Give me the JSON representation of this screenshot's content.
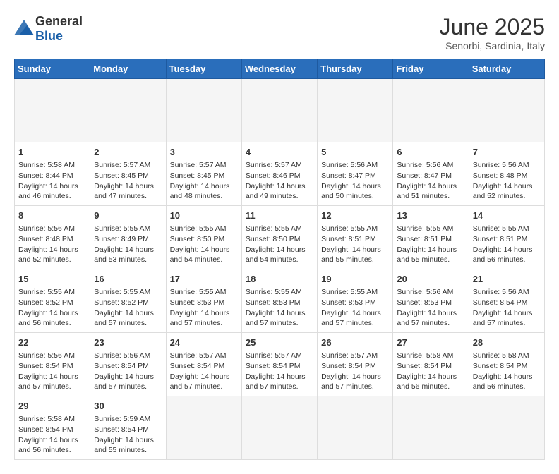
{
  "header": {
    "logo_general": "General",
    "logo_blue": "Blue",
    "title": "June 2025",
    "subtitle": "Senorbi, Sardinia, Italy"
  },
  "calendar": {
    "days_of_week": [
      "Sunday",
      "Monday",
      "Tuesday",
      "Wednesday",
      "Thursday",
      "Friday",
      "Saturday"
    ],
    "weeks": [
      [
        {
          "day": "",
          "empty": true
        },
        {
          "day": "",
          "empty": true
        },
        {
          "day": "",
          "empty": true
        },
        {
          "day": "",
          "empty": true
        },
        {
          "day": "",
          "empty": true
        },
        {
          "day": "",
          "empty": true
        },
        {
          "day": "",
          "empty": true
        }
      ],
      [
        {
          "day": "1",
          "sunrise": "5:58 AM",
          "sunset": "8:44 PM",
          "daylight": "14 hours and 46 minutes."
        },
        {
          "day": "2",
          "sunrise": "5:57 AM",
          "sunset": "8:45 PM",
          "daylight": "14 hours and 47 minutes."
        },
        {
          "day": "3",
          "sunrise": "5:57 AM",
          "sunset": "8:45 PM",
          "daylight": "14 hours and 48 minutes."
        },
        {
          "day": "4",
          "sunrise": "5:57 AM",
          "sunset": "8:46 PM",
          "daylight": "14 hours and 49 minutes."
        },
        {
          "day": "5",
          "sunrise": "5:56 AM",
          "sunset": "8:47 PM",
          "daylight": "14 hours and 50 minutes."
        },
        {
          "day": "6",
          "sunrise": "5:56 AM",
          "sunset": "8:47 PM",
          "daylight": "14 hours and 51 minutes."
        },
        {
          "day": "7",
          "sunrise": "5:56 AM",
          "sunset": "8:48 PM",
          "daylight": "14 hours and 52 minutes."
        }
      ],
      [
        {
          "day": "8",
          "sunrise": "5:56 AM",
          "sunset": "8:48 PM",
          "daylight": "14 hours and 52 minutes."
        },
        {
          "day": "9",
          "sunrise": "5:55 AM",
          "sunset": "8:49 PM",
          "daylight": "14 hours and 53 minutes."
        },
        {
          "day": "10",
          "sunrise": "5:55 AM",
          "sunset": "8:50 PM",
          "daylight": "14 hours and 54 minutes."
        },
        {
          "day": "11",
          "sunrise": "5:55 AM",
          "sunset": "8:50 PM",
          "daylight": "14 hours and 54 minutes."
        },
        {
          "day": "12",
          "sunrise": "5:55 AM",
          "sunset": "8:51 PM",
          "daylight": "14 hours and 55 minutes."
        },
        {
          "day": "13",
          "sunrise": "5:55 AM",
          "sunset": "8:51 PM",
          "daylight": "14 hours and 55 minutes."
        },
        {
          "day": "14",
          "sunrise": "5:55 AM",
          "sunset": "8:51 PM",
          "daylight": "14 hours and 56 minutes."
        }
      ],
      [
        {
          "day": "15",
          "sunrise": "5:55 AM",
          "sunset": "8:52 PM",
          "daylight": "14 hours and 56 minutes."
        },
        {
          "day": "16",
          "sunrise": "5:55 AM",
          "sunset": "8:52 PM",
          "daylight": "14 hours and 57 minutes."
        },
        {
          "day": "17",
          "sunrise": "5:55 AM",
          "sunset": "8:53 PM",
          "daylight": "14 hours and 57 minutes."
        },
        {
          "day": "18",
          "sunrise": "5:55 AM",
          "sunset": "8:53 PM",
          "daylight": "14 hours and 57 minutes."
        },
        {
          "day": "19",
          "sunrise": "5:55 AM",
          "sunset": "8:53 PM",
          "daylight": "14 hours and 57 minutes."
        },
        {
          "day": "20",
          "sunrise": "5:56 AM",
          "sunset": "8:53 PM",
          "daylight": "14 hours and 57 minutes."
        },
        {
          "day": "21",
          "sunrise": "5:56 AM",
          "sunset": "8:54 PM",
          "daylight": "14 hours and 57 minutes."
        }
      ],
      [
        {
          "day": "22",
          "sunrise": "5:56 AM",
          "sunset": "8:54 PM",
          "daylight": "14 hours and 57 minutes."
        },
        {
          "day": "23",
          "sunrise": "5:56 AM",
          "sunset": "8:54 PM",
          "daylight": "14 hours and 57 minutes."
        },
        {
          "day": "24",
          "sunrise": "5:57 AM",
          "sunset": "8:54 PM",
          "daylight": "14 hours and 57 minutes."
        },
        {
          "day": "25",
          "sunrise": "5:57 AM",
          "sunset": "8:54 PM",
          "daylight": "14 hours and 57 minutes."
        },
        {
          "day": "26",
          "sunrise": "5:57 AM",
          "sunset": "8:54 PM",
          "daylight": "14 hours and 57 minutes."
        },
        {
          "day": "27",
          "sunrise": "5:58 AM",
          "sunset": "8:54 PM",
          "daylight": "14 hours and 56 minutes."
        },
        {
          "day": "28",
          "sunrise": "5:58 AM",
          "sunset": "8:54 PM",
          "daylight": "14 hours and 56 minutes."
        }
      ],
      [
        {
          "day": "29",
          "sunrise": "5:58 AM",
          "sunset": "8:54 PM",
          "daylight": "14 hours and 56 minutes."
        },
        {
          "day": "30",
          "sunrise": "5:59 AM",
          "sunset": "8:54 PM",
          "daylight": "14 hours and 55 minutes."
        },
        {
          "day": "",
          "empty": true
        },
        {
          "day": "",
          "empty": true
        },
        {
          "day": "",
          "empty": true
        },
        {
          "day": "",
          "empty": true
        },
        {
          "day": "",
          "empty": true
        }
      ]
    ]
  }
}
